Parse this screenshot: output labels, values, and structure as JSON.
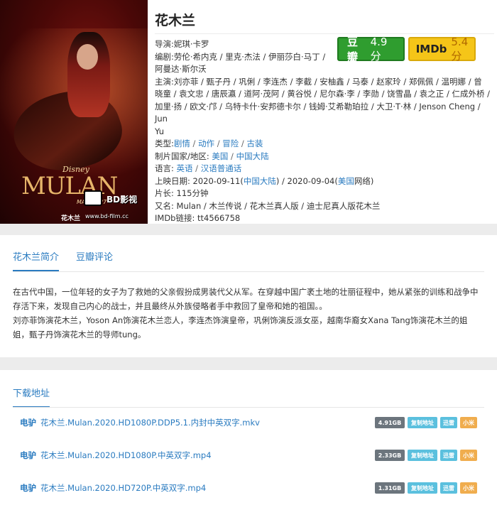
{
  "movie": {
    "title": "花木兰",
    "director_label": "导演:",
    "director": "妮琪·卡罗",
    "writers_label": "编剧:",
    "writers_line1": "劳伦·希内克 / 里克·杰法 / 伊丽莎白·马丁 /",
    "writers_line2": "阿曼达·斯尔沃",
    "cast_label": "主演:",
    "cast_line1": "刘亦菲 / 甄子丹 / 巩俐 / 李连杰 / 李截 / 安柚鑫 / 马泰 / 赵家玲 / 郑佩佩 / 温明娜 / 曾",
    "cast_line2": "晓童 / 袁文忠 / 唐辰瀛 / 道阿·茂阿 / 黄谷悦 / 尼尔森·李 / 李勋 / 饶雪晶 / 袁之正 / 仁成外桥 /",
    "cast_line3": "加里·扬 / 欧文·邝 / 乌特卡什·安邦德卡尔 / 钱姆·艾希勒珀拉 / 大卫·T·林 / Jenson Cheng / Jun",
    "cast_line4": "Yu",
    "genre_label": "类型:",
    "genres": [
      "剧情",
      "动作",
      "冒险",
      "古装"
    ],
    "region_label": "制片国家/地区:",
    "regions": [
      "美国",
      "中国大陆"
    ],
    "language_label": "语言:",
    "languages": [
      "英语",
      "汉语普通话"
    ],
    "release_label": "上映日期:",
    "release_1_date": "2020-09-11(",
    "release_1_place": "中国大陆",
    "release_1_end": ") / 2020-09-04(",
    "release_2_place": "美国",
    "release_2_end": "网络)",
    "runtime_label": "片长:",
    "runtime": "115分钟",
    "aka_label": "又名:",
    "aka": "Mulan / 木兰传说 / 花木兰真人版 / 迪士尼真人版花木兰",
    "imdb_label": "IMDb链接:",
    "imdb_id": "tt4566758"
  },
  "ratings": {
    "douban_label": "豆瓣",
    "douban_score": "4.9分",
    "imdb_label": "IMDb",
    "imdb_score": "5.4分"
  },
  "poster": {
    "studio": "Disney",
    "title": "MULAN",
    "date": "MARCH 27",
    "watermark_text": "BD影视",
    "watermark_cn": "花木兰",
    "watermark_url": "www.bd-film.cc"
  },
  "tabs": [
    {
      "label": "花木兰简介",
      "active": true
    },
    {
      "label": "豆瓣评论",
      "active": false
    }
  ],
  "synopsis": {
    "p1": "在古代中国，一位年轻的女子为了救她的父亲假扮成男装代父从军。在穿越中国广袤土地的壮丽征程中，她从紧张的训练和战争中存活下来，发现自己内心的战士，并且最终从外族侵略者手中救回了皇帝和她的祖国。。",
    "p2": "刘亦菲饰演花木兰，Yoson An饰演花木兰恋人，李连杰饰演皇帝，巩俐饰演反派女巫，越南华裔女Xana Tang饰演花木兰的姐姐，甄子丹饰演花木兰的导师tung。"
  },
  "downloads": {
    "title": "下载地址",
    "items": [
      {
        "proto": "电驴",
        "name": "花木兰.Mulan.2020.HD1080P.DDP5.1.内封中英双字.mkv",
        "size": "4.91GB",
        "copy": "复制地址",
        "xunlei": "迅雷",
        "xiaomi": "小米"
      },
      {
        "proto": "电驴",
        "name": "花木兰.Mulan.2020.HD1080P.中英双字.mp4",
        "size": "2.33GB",
        "copy": "复制地址",
        "xunlei": "迅雷",
        "xiaomi": "小米"
      },
      {
        "proto": "电驴",
        "name": "花木兰.Mulan.2020.HD720P.中英双字.mp4",
        "size": "1.31GB",
        "copy": "复制地址",
        "xunlei": "迅雷",
        "xiaomi": "小米"
      }
    ]
  }
}
